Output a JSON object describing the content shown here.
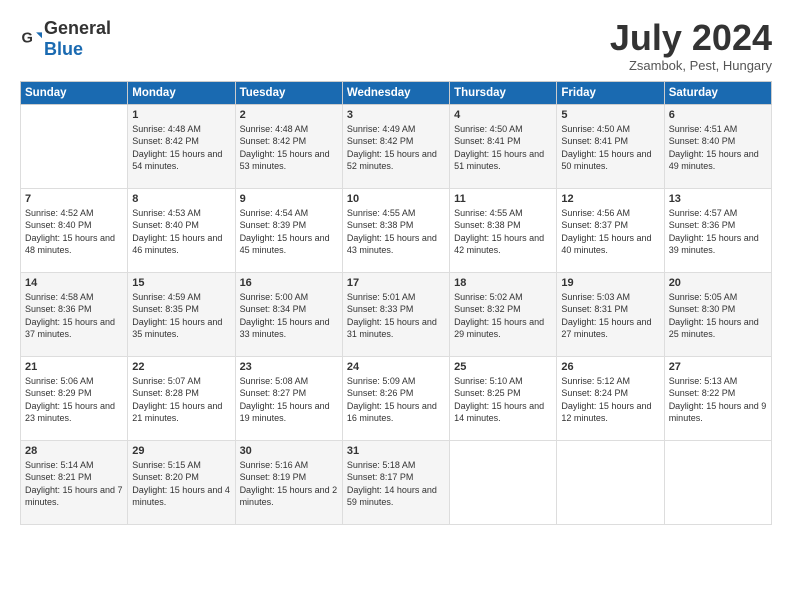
{
  "logo": {
    "general": "General",
    "blue": "Blue"
  },
  "header": {
    "month": "July 2024",
    "location": "Zsambok, Pest, Hungary"
  },
  "weekdays": [
    "Sunday",
    "Monday",
    "Tuesday",
    "Wednesday",
    "Thursday",
    "Friday",
    "Saturday"
  ],
  "weeks": [
    [
      {
        "day": "",
        "sunrise": "",
        "sunset": "",
        "daylight": ""
      },
      {
        "day": "1",
        "sunrise": "Sunrise: 4:48 AM",
        "sunset": "Sunset: 8:42 PM",
        "daylight": "Daylight: 15 hours and 54 minutes."
      },
      {
        "day": "2",
        "sunrise": "Sunrise: 4:48 AM",
        "sunset": "Sunset: 8:42 PM",
        "daylight": "Daylight: 15 hours and 53 minutes."
      },
      {
        "day": "3",
        "sunrise": "Sunrise: 4:49 AM",
        "sunset": "Sunset: 8:42 PM",
        "daylight": "Daylight: 15 hours and 52 minutes."
      },
      {
        "day": "4",
        "sunrise": "Sunrise: 4:50 AM",
        "sunset": "Sunset: 8:41 PM",
        "daylight": "Daylight: 15 hours and 51 minutes."
      },
      {
        "day": "5",
        "sunrise": "Sunrise: 4:50 AM",
        "sunset": "Sunset: 8:41 PM",
        "daylight": "Daylight: 15 hours and 50 minutes."
      },
      {
        "day": "6",
        "sunrise": "Sunrise: 4:51 AM",
        "sunset": "Sunset: 8:40 PM",
        "daylight": "Daylight: 15 hours and 49 minutes."
      }
    ],
    [
      {
        "day": "7",
        "sunrise": "Sunrise: 4:52 AM",
        "sunset": "Sunset: 8:40 PM",
        "daylight": "Daylight: 15 hours and 48 minutes."
      },
      {
        "day": "8",
        "sunrise": "Sunrise: 4:53 AM",
        "sunset": "Sunset: 8:40 PM",
        "daylight": "Daylight: 15 hours and 46 minutes."
      },
      {
        "day": "9",
        "sunrise": "Sunrise: 4:54 AM",
        "sunset": "Sunset: 8:39 PM",
        "daylight": "Daylight: 15 hours and 45 minutes."
      },
      {
        "day": "10",
        "sunrise": "Sunrise: 4:55 AM",
        "sunset": "Sunset: 8:38 PM",
        "daylight": "Daylight: 15 hours and 43 minutes."
      },
      {
        "day": "11",
        "sunrise": "Sunrise: 4:55 AM",
        "sunset": "Sunset: 8:38 PM",
        "daylight": "Daylight: 15 hours and 42 minutes."
      },
      {
        "day": "12",
        "sunrise": "Sunrise: 4:56 AM",
        "sunset": "Sunset: 8:37 PM",
        "daylight": "Daylight: 15 hours and 40 minutes."
      },
      {
        "day": "13",
        "sunrise": "Sunrise: 4:57 AM",
        "sunset": "Sunset: 8:36 PM",
        "daylight": "Daylight: 15 hours and 39 minutes."
      }
    ],
    [
      {
        "day": "14",
        "sunrise": "Sunrise: 4:58 AM",
        "sunset": "Sunset: 8:36 PM",
        "daylight": "Daylight: 15 hours and 37 minutes."
      },
      {
        "day": "15",
        "sunrise": "Sunrise: 4:59 AM",
        "sunset": "Sunset: 8:35 PM",
        "daylight": "Daylight: 15 hours and 35 minutes."
      },
      {
        "day": "16",
        "sunrise": "Sunrise: 5:00 AM",
        "sunset": "Sunset: 8:34 PM",
        "daylight": "Daylight: 15 hours and 33 minutes."
      },
      {
        "day": "17",
        "sunrise": "Sunrise: 5:01 AM",
        "sunset": "Sunset: 8:33 PM",
        "daylight": "Daylight: 15 hours and 31 minutes."
      },
      {
        "day": "18",
        "sunrise": "Sunrise: 5:02 AM",
        "sunset": "Sunset: 8:32 PM",
        "daylight": "Daylight: 15 hours and 29 minutes."
      },
      {
        "day": "19",
        "sunrise": "Sunrise: 5:03 AM",
        "sunset": "Sunset: 8:31 PM",
        "daylight": "Daylight: 15 hours and 27 minutes."
      },
      {
        "day": "20",
        "sunrise": "Sunrise: 5:05 AM",
        "sunset": "Sunset: 8:30 PM",
        "daylight": "Daylight: 15 hours and 25 minutes."
      }
    ],
    [
      {
        "day": "21",
        "sunrise": "Sunrise: 5:06 AM",
        "sunset": "Sunset: 8:29 PM",
        "daylight": "Daylight: 15 hours and 23 minutes."
      },
      {
        "day": "22",
        "sunrise": "Sunrise: 5:07 AM",
        "sunset": "Sunset: 8:28 PM",
        "daylight": "Daylight: 15 hours and 21 minutes."
      },
      {
        "day": "23",
        "sunrise": "Sunrise: 5:08 AM",
        "sunset": "Sunset: 8:27 PM",
        "daylight": "Daylight: 15 hours and 19 minutes."
      },
      {
        "day": "24",
        "sunrise": "Sunrise: 5:09 AM",
        "sunset": "Sunset: 8:26 PM",
        "daylight": "Daylight: 15 hours and 16 minutes."
      },
      {
        "day": "25",
        "sunrise": "Sunrise: 5:10 AM",
        "sunset": "Sunset: 8:25 PM",
        "daylight": "Daylight: 15 hours and 14 minutes."
      },
      {
        "day": "26",
        "sunrise": "Sunrise: 5:12 AM",
        "sunset": "Sunset: 8:24 PM",
        "daylight": "Daylight: 15 hours and 12 minutes."
      },
      {
        "day": "27",
        "sunrise": "Sunrise: 5:13 AM",
        "sunset": "Sunset: 8:22 PM",
        "daylight": "Daylight: 15 hours and 9 minutes."
      }
    ],
    [
      {
        "day": "28",
        "sunrise": "Sunrise: 5:14 AM",
        "sunset": "Sunset: 8:21 PM",
        "daylight": "Daylight: 15 hours and 7 minutes."
      },
      {
        "day": "29",
        "sunrise": "Sunrise: 5:15 AM",
        "sunset": "Sunset: 8:20 PM",
        "daylight": "Daylight: 15 hours and 4 minutes."
      },
      {
        "day": "30",
        "sunrise": "Sunrise: 5:16 AM",
        "sunset": "Sunset: 8:19 PM",
        "daylight": "Daylight: 15 hours and 2 minutes."
      },
      {
        "day": "31",
        "sunrise": "Sunrise: 5:18 AM",
        "sunset": "Sunset: 8:17 PM",
        "daylight": "Daylight: 14 hours and 59 minutes."
      },
      {
        "day": "",
        "sunrise": "",
        "sunset": "",
        "daylight": ""
      },
      {
        "day": "",
        "sunrise": "",
        "sunset": "",
        "daylight": ""
      },
      {
        "day": "",
        "sunrise": "",
        "sunset": "",
        "daylight": ""
      }
    ]
  ]
}
